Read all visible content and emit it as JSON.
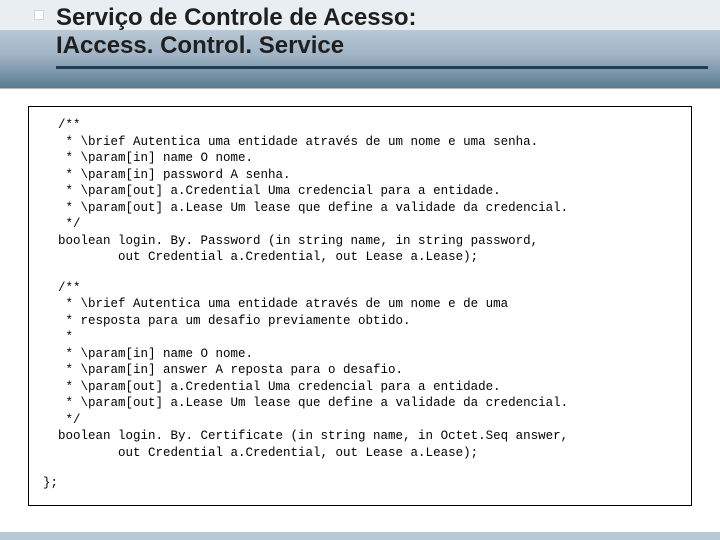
{
  "header": {
    "line1": "Serviço de Controle de Acesso:",
    "line2": "IAccess. Control. Service"
  },
  "code": {
    "block1": "  /**\n   * \\brief Autentica uma entidade através de um nome e uma senha.\n   * \\param[in] name O nome.\n   * \\param[in] password A senha.\n   * \\param[out] a.Credential Uma credencial para a entidade.\n   * \\param[out] a.Lease Um lease que define a validade da credencial.\n   */\n  boolean login. By. Password (in string name, in string password,\n          out Credential a.Credential, out Lease a.Lease);",
    "block2": "  /**\n   * \\brief Autentica uma entidade através de um nome e de uma\n   * resposta para um desafio previamente obtido.\n   *\n   * \\param[in] name O nome.\n   * \\param[in] answer A reposta para o desafio.\n   * \\param[out] a.Credential Uma credencial para a entidade.\n   * \\param[out] a.Lease Um lease que define a validade da credencial.\n   */\n  boolean login. By. Certificate (in string name, in Octet.Seq answer,\n          out Credential a.Credential, out Lease a.Lease);",
    "close": "};"
  }
}
